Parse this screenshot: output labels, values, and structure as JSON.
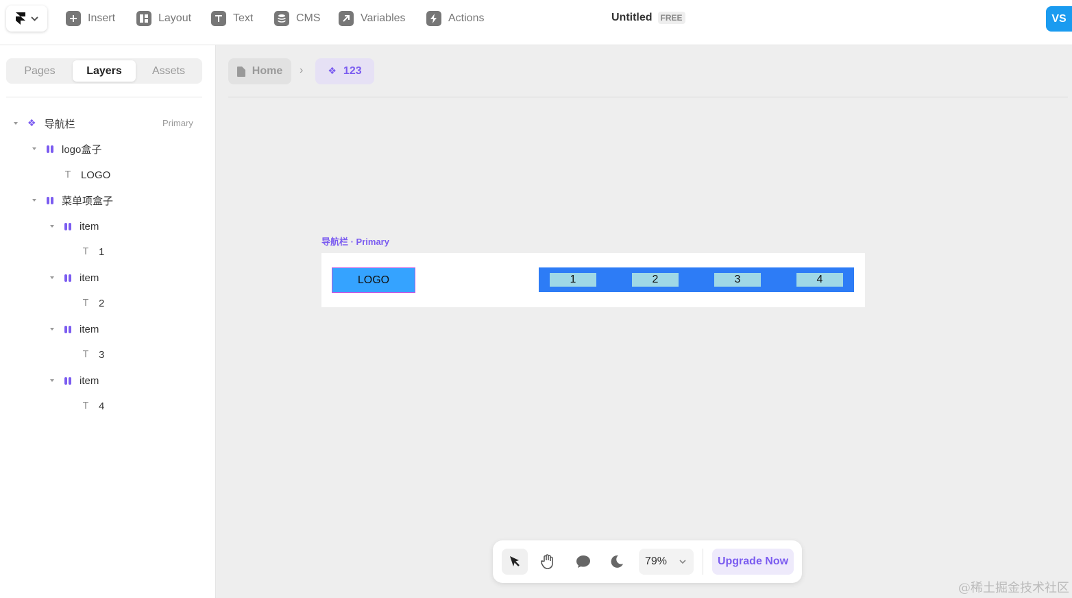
{
  "topbar": {
    "menu": [
      {
        "label": "Insert",
        "icon": "plus-square-icon"
      },
      {
        "label": "Layout",
        "icon": "layout-icon"
      },
      {
        "label": "Text",
        "icon": "text-t-icon"
      },
      {
        "label": "CMS",
        "icon": "database-icon"
      },
      {
        "label": "Variables",
        "icon": "arrow-up-right-icon"
      },
      {
        "label": "Actions",
        "icon": "lightning-icon"
      }
    ],
    "doc_title": "Untitled",
    "plan_badge": "FREE",
    "avatar_initials": "VS"
  },
  "sidebar": {
    "tabs": [
      "Pages",
      "Layers",
      "Assets"
    ],
    "active_tab": "Layers",
    "layers": [
      {
        "label": "导航栏",
        "type": "component",
        "tag": "Primary"
      },
      {
        "label": "logo盒子",
        "type": "frame"
      },
      {
        "label": "LOGO",
        "type": "text"
      },
      {
        "label": "菜单项盒子",
        "type": "frame"
      },
      {
        "label": "item",
        "type": "frame"
      },
      {
        "label": "1",
        "type": "text"
      },
      {
        "label": "item",
        "type": "frame"
      },
      {
        "label": "2",
        "type": "text"
      },
      {
        "label": "item",
        "type": "frame"
      },
      {
        "label": "3",
        "type": "text"
      },
      {
        "label": "item",
        "type": "frame"
      },
      {
        "label": "4",
        "type": "text"
      }
    ]
  },
  "breadcrumb": {
    "home": "Home",
    "component": "123"
  },
  "canvas": {
    "frame_label": "导航栏 · Primary",
    "logo_text": "LOGO",
    "menu_items": [
      "1",
      "2",
      "3",
      "4"
    ]
  },
  "bottom_bar": {
    "tools": [
      "cursor-icon",
      "hand-icon",
      "comment-icon",
      "moon-icon"
    ],
    "zoom": "79%",
    "upgrade_label": "Upgrade Now"
  },
  "watermark": "@稀土掘金技术社区",
  "colors": {
    "accent": "#7b5cf0",
    "logo_box": "#35a3ff",
    "menu_box": "#2d7cf6",
    "menu_item": "#9fd8e6",
    "avatar": "#1a9bf0"
  }
}
